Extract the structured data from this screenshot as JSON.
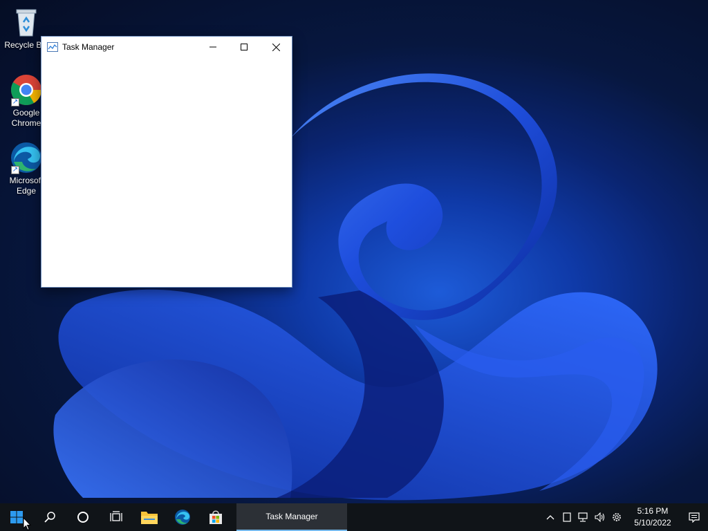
{
  "desktop": {
    "icons": [
      {
        "label": "Recycle Bin",
        "icon": "recycle-bin-icon"
      },
      {
        "label": "Google Chrome",
        "label_line1": "Google",
        "label_line2": "Chrome",
        "icon": "chrome-icon"
      },
      {
        "label": "Microsoft Edge",
        "label_line1": "Microsoft",
        "label_line2": "Edge",
        "icon": "edge-icon"
      }
    ]
  },
  "window": {
    "title": "Task Manager",
    "icon": "task-manager-icon",
    "buttons": {
      "minimize": "minimize-icon",
      "maximize": "maximize-icon",
      "close": "close-icon"
    }
  },
  "taskbar": {
    "pinned": [
      "start",
      "search",
      "cortana",
      "task-view",
      "file-explorer",
      "edge",
      "store"
    ],
    "active_task": "Task Manager",
    "tray": [
      "chevron-up-icon",
      "tablet-icon",
      "network-icon",
      "volume-icon",
      "settings-icon"
    ],
    "clock": {
      "time": "5:16 PM",
      "date": "5/10/2022"
    },
    "notification_icon": "notification-icon"
  },
  "colors": {
    "accent": "#76b9ed",
    "taskbar": "#101418",
    "window_bg": "#ffffff"
  }
}
